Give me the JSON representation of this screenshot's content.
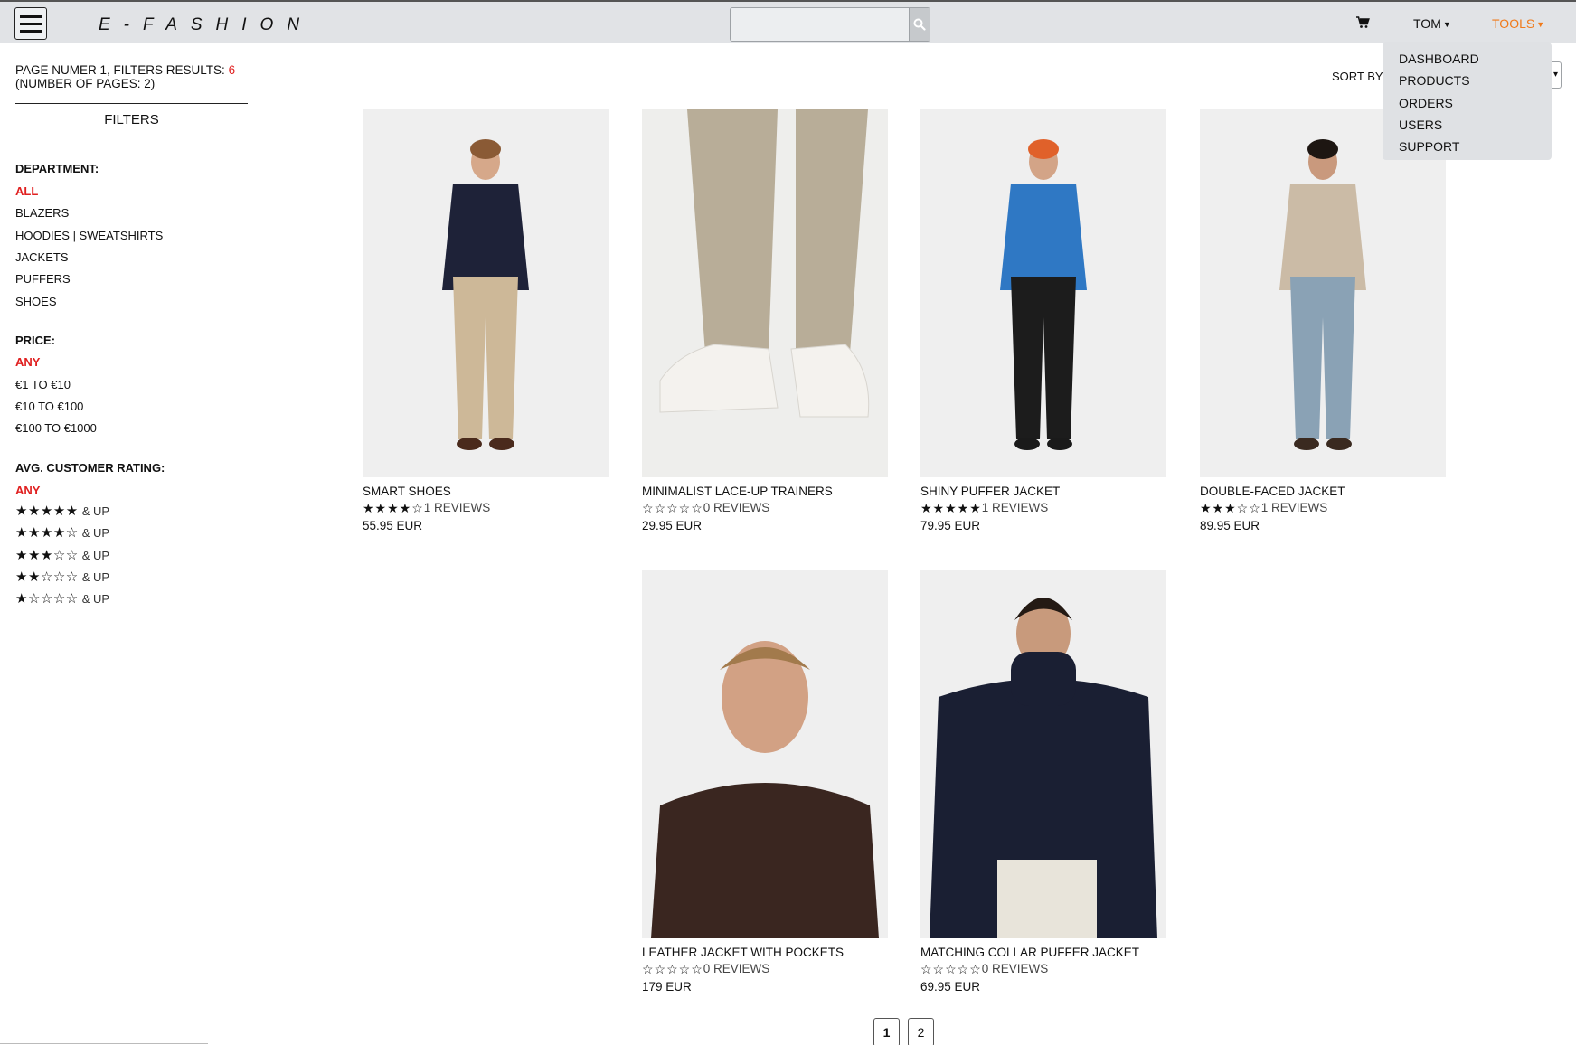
{
  "header": {
    "brand": "E-FASHION",
    "search_placeholder": "",
    "user": "TOM",
    "tools": "TOOLS"
  },
  "tools_menu": [
    "DASHBOARD",
    "PRODUCTS",
    "ORDERS",
    "USERS",
    "SUPPORT"
  ],
  "results": {
    "line1": "PAGE NUMER 1, FILTERS RESULTS:",
    "count": "6",
    "line2": "(NUMBER OF PAGES: 2)"
  },
  "filters": {
    "title": "FILTERS",
    "department": {
      "title": "DEPARTMENT:",
      "items": [
        "ALL",
        "BLAZERS",
        "HOODIES | SWEATSHIRTS",
        "JACKETS",
        "PUFFERS",
        "SHOES"
      ]
    },
    "price": {
      "title": "PRICE:",
      "items": [
        "ANY",
        "€1 TO €10",
        "€10 TO €100",
        "€100 TO €1000"
      ]
    },
    "rating": {
      "title": "AVG. CUSTOMER RATING:",
      "any": "ANY",
      "and_up": "& UP",
      "levels": [
        5,
        4,
        3,
        2,
        1
      ]
    }
  },
  "sort": {
    "label": "SORT BY"
  },
  "products": [
    {
      "name": "SMART SHOES",
      "rating": 4,
      "reviews": "1 REVIEWS",
      "price": "55.95 EUR",
      "image": "man-navy-polo-beige-trousers",
      "colors": {
        "top": "#1e2238",
        "bottom": "#cdb898",
        "shoes": "#4a2a1c",
        "skin": "#d6a88a",
        "hair": "#8a5a35"
      }
    },
    {
      "name": "MINIMALIST LACE-UP TRAINERS",
      "rating": 0,
      "reviews": "0 REVIEWS",
      "price": "29.95 EUR",
      "image": "white-trainers-beige-trousers",
      "colors": {
        "bottom": "#b8ad98",
        "shoes": "#f4f2ee"
      }
    },
    {
      "name": "SHINY PUFFER JACKET",
      "rating": 5,
      "reviews": "1 REVIEWS",
      "price": "79.95 EUR",
      "image": "man-blue-puffer-jacket",
      "colors": {
        "top": "#2f78c4",
        "bottom": "#1c1c1c",
        "shoes": "#1a1a1a",
        "skin": "#d3a487",
        "hair": "#e0612a"
      }
    },
    {
      "name": "DOUBLE-FACED JACKET",
      "rating": 3,
      "reviews": "1 REVIEWS",
      "price": "89.95 EUR",
      "image": "man-shearling-jacket-jeans",
      "colors": {
        "top": "#cbbba6",
        "bottom": "#8aa2b5",
        "shoes": "#3a2a20",
        "skin": "#c9997d",
        "hair": "#1d1612"
      }
    },
    {
      "name": "LEATHER JACKET WITH POCKETS",
      "rating": 0,
      "reviews": "0 REVIEWS",
      "price": "179 EUR",
      "image": "man-brown-leather-jacket",
      "colors": {
        "top": "#3a2620",
        "skin": "#d2a184",
        "hair": "#a27a4c"
      }
    },
    {
      "name": "MATCHING COLLAR PUFFER JACKET",
      "rating": 0,
      "reviews": "0 REVIEWS",
      "price": "69.95 EUR",
      "image": "man-navy-puffer-jacket",
      "colors": {
        "top": "#1a1f33",
        "bottom": "#e8e4da",
        "skin": "#c89a7c",
        "hair": "#241a14"
      }
    }
  ],
  "pagination": [
    "1",
    "2"
  ],
  "colors": {
    "accent": "#f07a1a",
    "active_filter": "#e02020",
    "topbar": "#e1e3e6"
  }
}
